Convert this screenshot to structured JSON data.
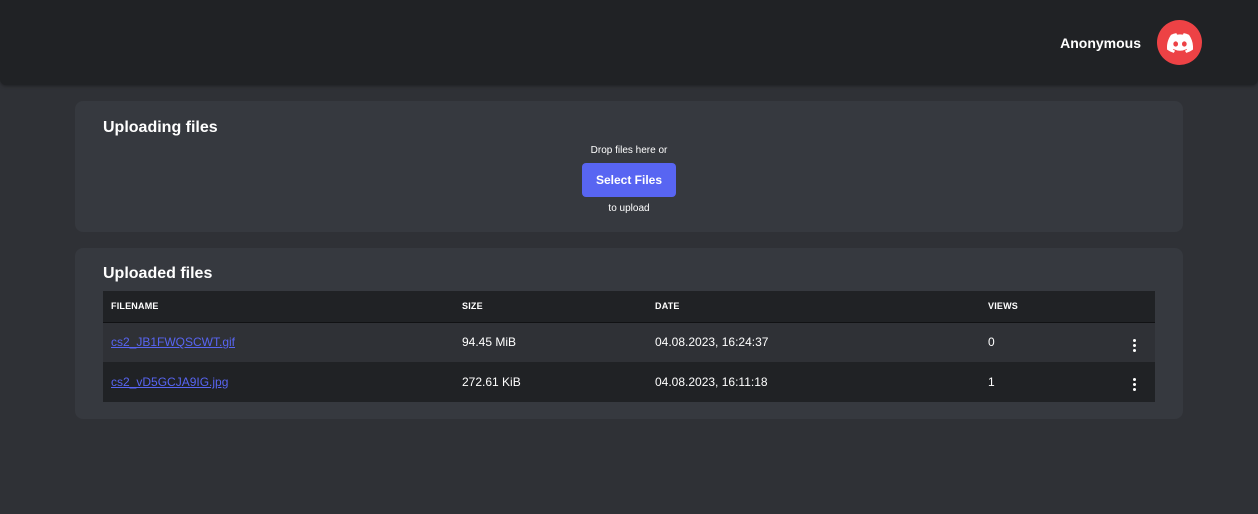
{
  "header": {
    "user_name": "Anonymous",
    "avatar_icon": "discord-icon",
    "avatar_color": "#ed4245"
  },
  "upload": {
    "title": "Uploading files",
    "drop_hint": "Drop files here or",
    "select_button": "Select Files",
    "drop_suffix": "to upload",
    "accent": "#5865f2"
  },
  "files": {
    "title": "Uploaded files",
    "columns": [
      "FILENAME",
      "SIZE",
      "DATE",
      "VIEWS",
      ""
    ],
    "rows": [
      {
        "filename": "cs2_JB1FWQSCWT.gif",
        "size": "94.45 MiB",
        "date": "04.08.2023, 16:24:37",
        "views": "0",
        "actions_icon": "kebab-menu-icon"
      },
      {
        "filename": "cs2_vD5GCJA9IG.jpg",
        "size": "272.61 KiB",
        "date": "04.08.2023, 16:11:18",
        "views": "1",
        "actions_icon": "kebab-menu-icon"
      }
    ]
  }
}
